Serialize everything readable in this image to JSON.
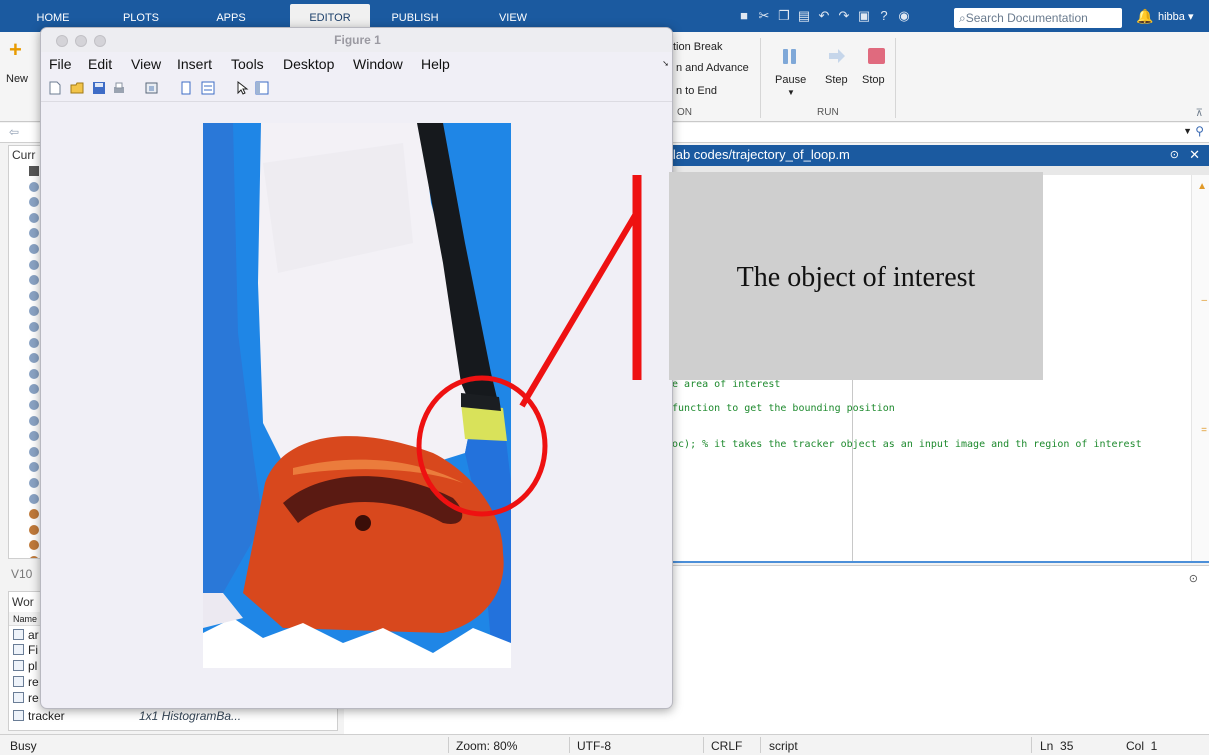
{
  "app": {
    "tabs": [
      "HOME",
      "PLOTS",
      "APPS",
      "EDITOR",
      "PUBLISH",
      "VIEW"
    ],
    "active_tab": "EDITOR",
    "search_placeholder": "Search Documentation",
    "user": "hibba",
    "accent_color": "#1b5aa0"
  },
  "toolstrip": {
    "new_label": "New",
    "breakpoint_items": [
      "tion Break",
      "n and Advance",
      "n to End"
    ],
    "section_group_label": "ON",
    "run": {
      "pause": "Pause",
      "step": "Step",
      "stop": "Stop",
      "group_label": "RUN"
    }
  },
  "current_folder": {
    "title": "Curr",
    "status": "V10"
  },
  "workspace": {
    "title": "Wor",
    "name_header": "Name",
    "rows": [
      {
        "name": "ar",
        "value": "",
        "icon": "matrix-icon"
      },
      {
        "name": "Fi",
        "value": "",
        "icon": "matrix-icon"
      },
      {
        "name": "pl",
        "value": "",
        "icon": "object-icon"
      },
      {
        "name": "re",
        "value": "",
        "icon": "object-icon"
      },
      {
        "name": "re",
        "value": "",
        "icon": "object-icon"
      },
      {
        "name": "tracker",
        "value": "1x1 HistogramBa...",
        "icon": "object-icon"
      }
    ]
  },
  "editor": {
    "path": "atlab codes/trajectory_of_loop.m",
    "code_lines": [
      "ne area of interest",
      " function to get the bounding position",
      "Loc); % it takes the tracker object as an input image and th region of interest"
    ]
  },
  "figure": {
    "title": "Figure 1",
    "menu": [
      "File",
      "Edit",
      "View",
      "Insert",
      "Tools",
      "Desktop",
      "Window",
      "Help"
    ]
  },
  "annotation": {
    "text": "The object of interest",
    "color": "#ee1111"
  },
  "status": {
    "state": "Busy",
    "zoom": "Zoom: 80%",
    "encoding": "UTF-8",
    "line_ending": "CRLF",
    "type": "script",
    "line": "Ln  35",
    "col": "Col  1"
  }
}
